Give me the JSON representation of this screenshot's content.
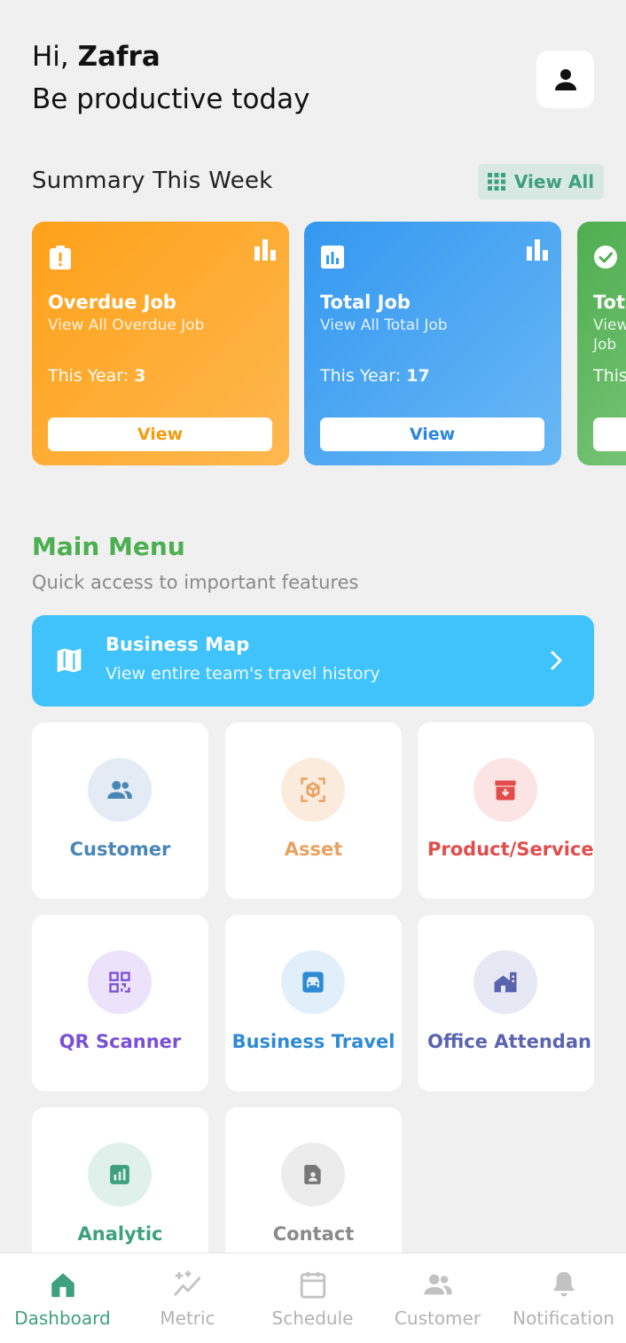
{
  "header": {
    "greeting_prefix": "Hi,",
    "user_name": "Zafra",
    "tagline": "Be productive today"
  },
  "summary": {
    "title": "Summary This Week",
    "view_all_label": "View All",
    "cards": [
      {
        "title": "Overdue Job",
        "subtitle": "View All Overdue Job",
        "year_label": "This Year:",
        "year_value": "3",
        "button_label": "View",
        "color": "#fea11a"
      },
      {
        "title": "Total Job",
        "subtitle": "View All Total Job",
        "year_label": "This Year:",
        "year_value": "17",
        "button_label": "View",
        "color": "#3498f0"
      },
      {
        "title": "Tot",
        "subtitle_line1": "View",
        "subtitle_line2": "Job",
        "year_label": "This",
        "color": "#4fae4f"
      }
    ]
  },
  "main_menu": {
    "title": "Main Menu",
    "subtitle": "Quick access to important features",
    "business_map": {
      "title": "Business Map",
      "subtitle": "View entire team's travel history"
    },
    "tiles": [
      {
        "label": "Customer",
        "color": "#4a86b5"
      },
      {
        "label": "Asset",
        "color": "#e9a15f"
      },
      {
        "label": "Product/Service",
        "color": "#e14d4d"
      },
      {
        "label": "QR Scanner",
        "color": "#7b4fd6"
      },
      {
        "label": "Business Travel",
        "color": "#2f8ad6"
      },
      {
        "label": "Office Attendan",
        "color": "#5a63b0"
      },
      {
        "label": "Analytic",
        "color": "#3ea07f"
      },
      {
        "label": "Contact",
        "color": "#8a8a8a"
      }
    ]
  },
  "bottom_nav": {
    "items": [
      {
        "label": "Dashboard",
        "active": true
      },
      {
        "label": "Metric",
        "active": false
      },
      {
        "label": "Schedule",
        "active": false
      },
      {
        "label": "Customer",
        "active": false
      },
      {
        "label": "Notification",
        "active": false
      }
    ],
    "active_color": "#3ea07f"
  }
}
